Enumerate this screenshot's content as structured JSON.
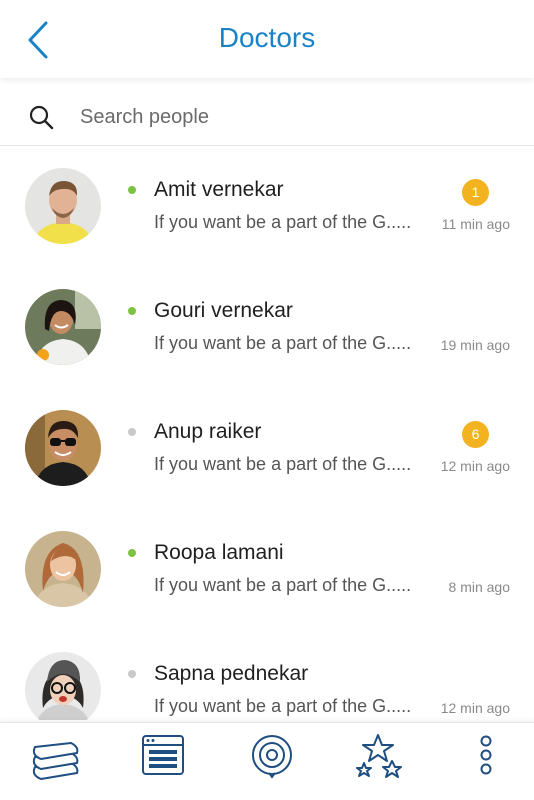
{
  "header": {
    "title": "Doctors"
  },
  "search": {
    "placeholder": "Search people"
  },
  "colors": {
    "accent": "#1a83c7",
    "badge": "#f3b21f",
    "online": "#7dc242",
    "offline": "#c9c9c9"
  },
  "contacts": [
    {
      "name": "Amit vernekar",
      "message": "If you want be a part of the G.....",
      "time": "11 min ago",
      "badge": "1",
      "online": true
    },
    {
      "name": "Gouri vernekar",
      "message": "If you want be a part of the G.....",
      "time": "19 min ago",
      "badge": "",
      "online": true
    },
    {
      "name": "Anup raiker",
      "message": "If you want be a part of the G.....",
      "time": "12 min ago",
      "badge": "6",
      "online": false
    },
    {
      "name": "Roopa lamani",
      "message": "If you want be a part of the G.....",
      "time": "8 min ago",
      "badge": "",
      "online": true
    },
    {
      "name": "Sapna pednekar",
      "message": "If you want be a part of the G.....",
      "time": "12 min ago",
      "badge": "",
      "online": false
    }
  ],
  "bottom_nav": [
    {
      "icon": "layers-icon"
    },
    {
      "icon": "news-icon"
    },
    {
      "icon": "target-icon"
    },
    {
      "icon": "stars-icon"
    },
    {
      "icon": "more-vertical-icon"
    }
  ]
}
